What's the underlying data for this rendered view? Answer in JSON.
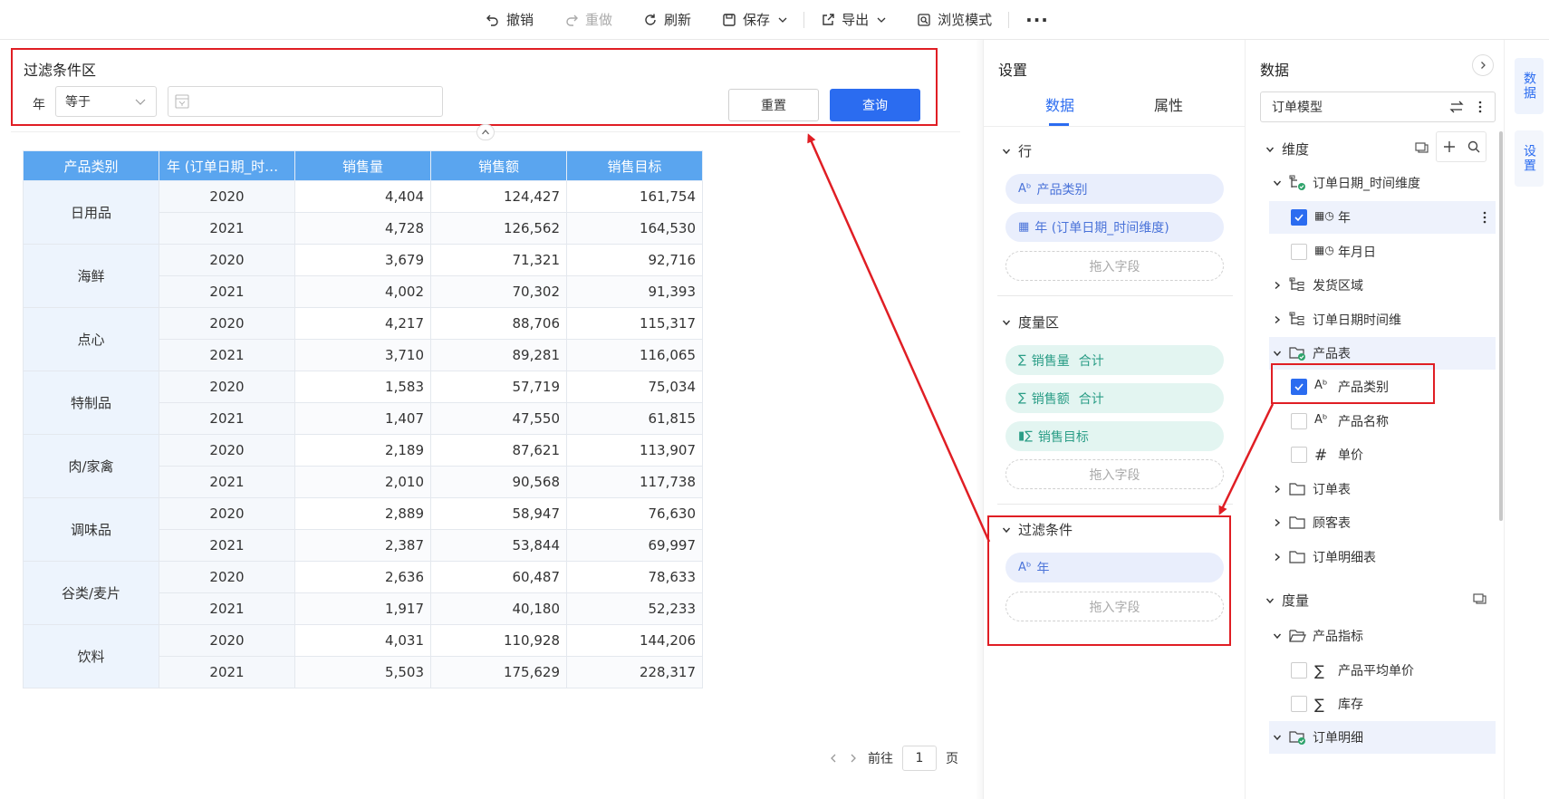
{
  "toolbar": {
    "undo": "撤销",
    "redo": "重做",
    "refresh": "刷新",
    "save": "保存",
    "export": "导出",
    "browse": "浏览模式"
  },
  "filter": {
    "title": "过滤条件区",
    "field_label": "年",
    "operator": "等于",
    "reset": "重置",
    "query": "查询"
  },
  "table": {
    "headers": [
      "产品类别",
      "年 (订单日期_时间...",
      "销售量",
      "销售额",
      "销售目标"
    ],
    "groups": [
      {
        "category": "日用品",
        "rows": [
          [
            "2020",
            "4,404",
            "124,427",
            "161,754"
          ],
          [
            "2021",
            "4,728",
            "126,562",
            "164,530"
          ]
        ]
      },
      {
        "category": "海鲜",
        "rows": [
          [
            "2020",
            "3,679",
            "71,321",
            "92,716"
          ],
          [
            "2021",
            "4,002",
            "70,302",
            "91,393"
          ]
        ]
      },
      {
        "category": "点心",
        "rows": [
          [
            "2020",
            "4,217",
            "88,706",
            "115,317"
          ],
          [
            "2021",
            "3,710",
            "89,281",
            "116,065"
          ]
        ]
      },
      {
        "category": "特制品",
        "rows": [
          [
            "2020",
            "1,583",
            "57,719",
            "75,034"
          ],
          [
            "2021",
            "1,407",
            "47,550",
            "61,815"
          ]
        ]
      },
      {
        "category": "肉/家禽",
        "rows": [
          [
            "2020",
            "2,189",
            "87,621",
            "113,907"
          ],
          [
            "2021",
            "2,010",
            "90,568",
            "117,738"
          ]
        ]
      },
      {
        "category": "调味品",
        "rows": [
          [
            "2020",
            "2,889",
            "58,947",
            "76,630"
          ],
          [
            "2021",
            "2,387",
            "53,844",
            "69,997"
          ]
        ]
      },
      {
        "category": "谷类/麦片",
        "rows": [
          [
            "2020",
            "2,636",
            "60,487",
            "78,633"
          ],
          [
            "2021",
            "1,917",
            "40,180",
            "52,233"
          ]
        ]
      },
      {
        "category": "饮料",
        "rows": [
          [
            "2020",
            "4,031",
            "110,928",
            "144,206"
          ],
          [
            "2021",
            "5,503",
            "175,629",
            "228,317"
          ]
        ]
      }
    ]
  },
  "pager": {
    "prefix": "前往",
    "page": "1",
    "suffix": "页"
  },
  "settings": {
    "title": "设置",
    "tab_data": "数据",
    "tab_props": "属性",
    "rows_title": "行",
    "rows": [
      "产品类别",
      "年 (订单日期_时间维度)"
    ],
    "drop": "拖入字段",
    "measures_title": "度量区",
    "measures": [
      {
        "name": "销售量",
        "agg": "合计"
      },
      {
        "name": "销售额",
        "agg": "合计"
      },
      {
        "name": "销售目标",
        "agg": ""
      }
    ],
    "filters_title": "过滤条件",
    "filters": [
      "年"
    ]
  },
  "data": {
    "title": "数据",
    "model": "订单模型",
    "dim_title": "维度",
    "tree": [
      {
        "label": "订单日期_时间维度"
      },
      {
        "label": "年"
      },
      {
        "label": "年月日"
      },
      {
        "label": "发货区域"
      },
      {
        "label": "订单日期时间维"
      },
      {
        "label": "产品表"
      },
      {
        "label": "产品类别"
      },
      {
        "label": "产品名称"
      },
      {
        "label": "单价"
      },
      {
        "label": "订单表"
      },
      {
        "label": "顾客表"
      },
      {
        "label": "订单明细表"
      }
    ],
    "measure_title": "度量",
    "measure_tree": [
      {
        "label": "产品指标"
      },
      {
        "label": "产品平均单价"
      },
      {
        "label": "库存"
      },
      {
        "label": "订单明细"
      }
    ]
  },
  "vtabs": {
    "data": "数据",
    "settings": "设置"
  },
  "colors": {
    "primary": "#2b6cf0",
    "header": "#5aa5ef",
    "annotation": "#e01e24"
  }
}
